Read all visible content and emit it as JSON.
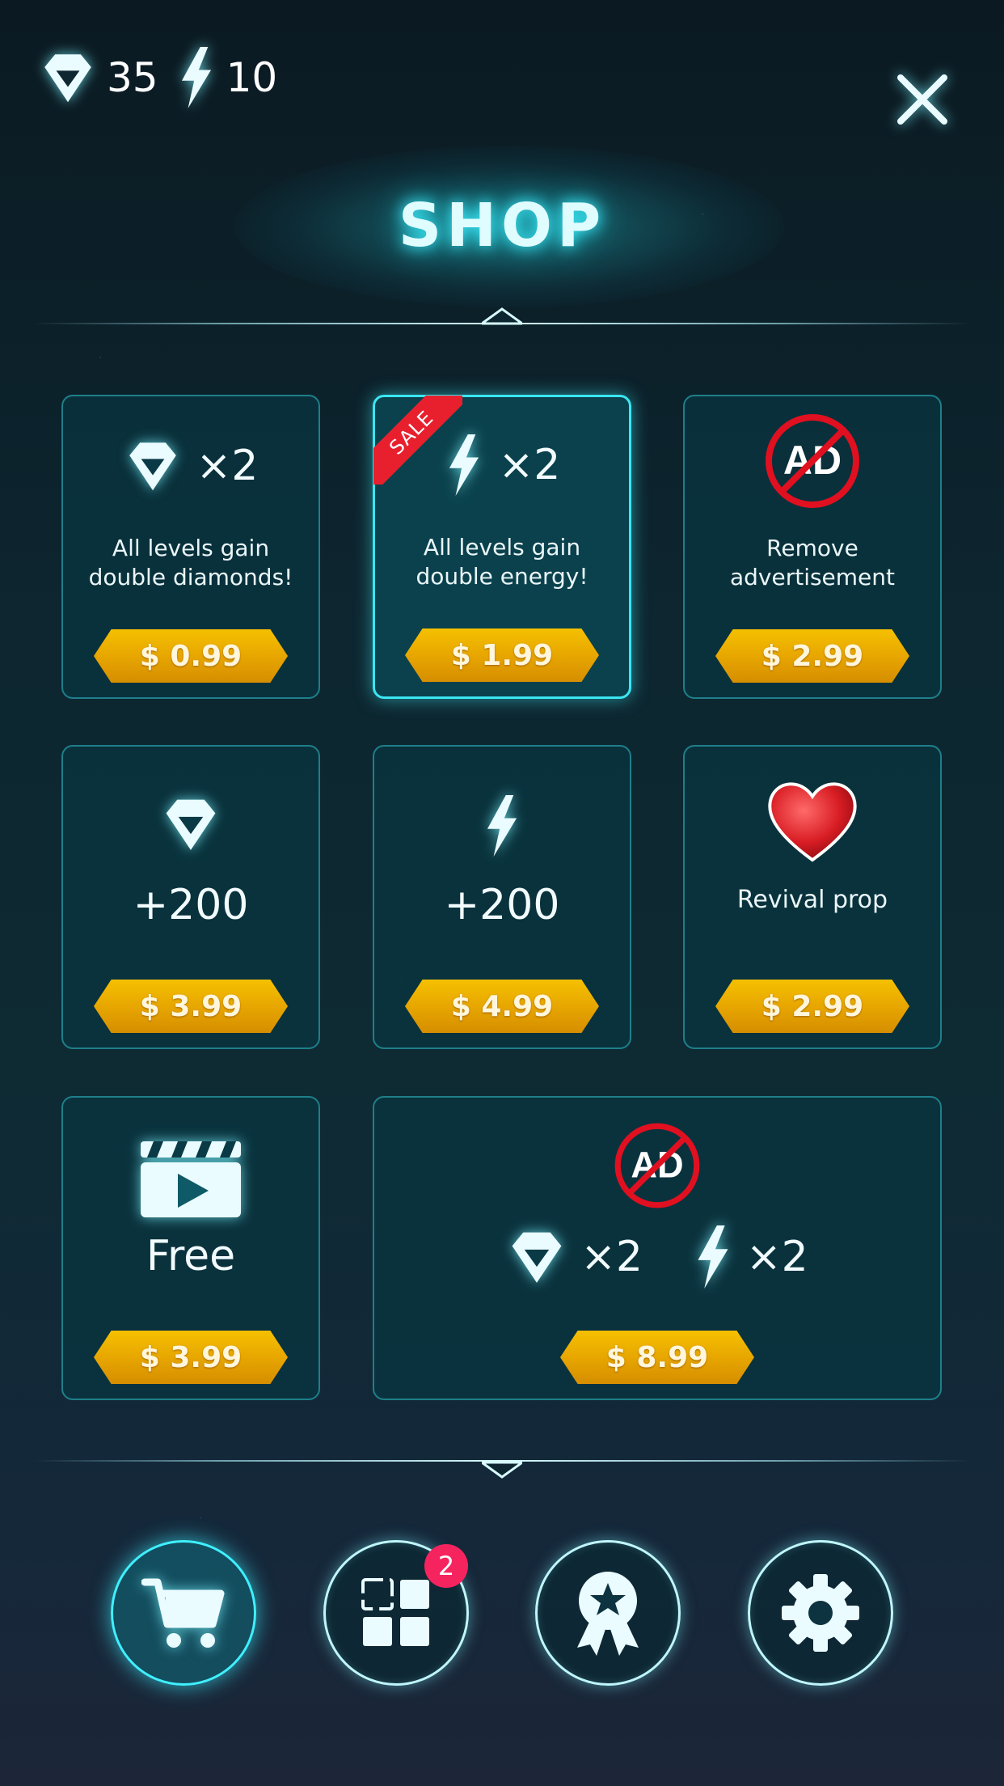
{
  "hud": {
    "diamonds": "35",
    "energy": "10"
  },
  "title": "SHOP",
  "cards": {
    "double_diamonds": {
      "mult": "×2",
      "desc1": "All levels gain",
      "desc2": "double diamonds!",
      "price": "$ 0.99"
    },
    "double_energy": {
      "sale": "SALE",
      "mult": "×2",
      "desc1": "All levels gain",
      "desc2": "double energy!",
      "price": "$ 1.99"
    },
    "remove_ads": {
      "ad": "AD",
      "desc1": "Remove",
      "desc2": "advertisement",
      "price": "$ 2.99"
    },
    "diamonds_200": {
      "amount": "+200",
      "price": "$ 3.99"
    },
    "energy_200": {
      "amount": "+200",
      "price": "$ 4.99"
    },
    "revival": {
      "label": "Revival prop",
      "price": "$ 2.99"
    },
    "free_video": {
      "label": "Free",
      "price": "$ 3.99"
    },
    "bundle": {
      "ad": "AD",
      "mult_diamond": "×2",
      "mult_energy": "×2",
      "price": "$ 8.99"
    }
  },
  "nav": {
    "items_badge": "2"
  },
  "icons": [
    "diamond-icon",
    "lightning-icon",
    "close-icon",
    "no-ad-icon",
    "heart-icon",
    "video-icon",
    "cart-icon",
    "grid-icon",
    "award-icon",
    "gear-icon"
  ],
  "colors": {
    "accent": "#3ae6f2",
    "price": "#e6a400",
    "sale": "#e8202e",
    "badge": "#f5245f"
  }
}
